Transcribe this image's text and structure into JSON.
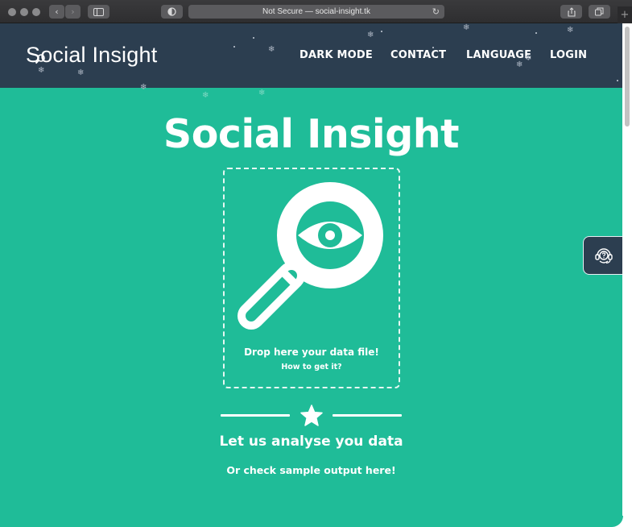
{
  "browser": {
    "url_text": "Not Secure — social-insight.tk",
    "new_tab_glyph": "+"
  },
  "header": {
    "logo_text": "Social Insight",
    "nav": [
      "DARK MODE",
      "CONTACT",
      "LANGUAGE",
      "LOGIN"
    ]
  },
  "main": {
    "title": "Social Insight",
    "drop_label": "Drop here your data file!",
    "how_link": "How to get it?",
    "sub_heading": "Let us analyse you data",
    "sample_link": "Or check sample output here!"
  },
  "icons": {
    "hero": "magnifier-eye-icon",
    "divider": "star-icon",
    "support": "support-agent-icon"
  },
  "colors": {
    "background": "#1fbc98",
    "header": "#2c3e50",
    "text": "#ffffff"
  }
}
